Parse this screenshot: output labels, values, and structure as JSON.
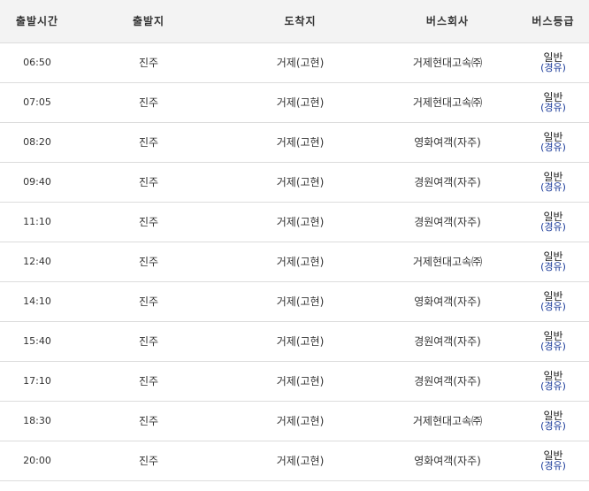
{
  "header": {
    "time": "출발시간",
    "from": "출발지",
    "to": "도착지",
    "company": "버스회사",
    "grade": "버스등급"
  },
  "rows": [
    {
      "time": "06:50",
      "from": "진주",
      "to": "거제(고현)",
      "company": "거제현대고속㈜",
      "grade": "일반",
      "grade_note": "(경유)"
    },
    {
      "time": "07:05",
      "from": "진주",
      "to": "거제(고현)",
      "company": "거제현대고속㈜",
      "grade": "일반",
      "grade_note": "(경유)"
    },
    {
      "time": "08:20",
      "from": "진주",
      "to": "거제(고현)",
      "company": "영화여객(자주)",
      "grade": "일반",
      "grade_note": "(경유)"
    },
    {
      "time": "09:40",
      "from": "진주",
      "to": "거제(고현)",
      "company": "경원여객(자주)",
      "grade": "일반",
      "grade_note": "(경유)"
    },
    {
      "time": "11:10",
      "from": "진주",
      "to": "거제(고현)",
      "company": "경원여객(자주)",
      "grade": "일반",
      "grade_note": "(경유)"
    },
    {
      "time": "12:40",
      "from": "진주",
      "to": "거제(고현)",
      "company": "거제현대고속㈜",
      "grade": "일반",
      "grade_note": "(경유)"
    },
    {
      "time": "14:10",
      "from": "진주",
      "to": "거제(고현)",
      "company": "영화여객(자주)",
      "grade": "일반",
      "grade_note": "(경유)"
    },
    {
      "time": "15:40",
      "from": "진주",
      "to": "거제(고현)",
      "company": "경원여객(자주)",
      "grade": "일반",
      "grade_note": "(경유)"
    },
    {
      "time": "17:10",
      "from": "진주",
      "to": "거제(고현)",
      "company": "경원여객(자주)",
      "grade": "일반",
      "grade_note": "(경유)"
    },
    {
      "time": "18:30",
      "from": "진주",
      "to": "거제(고현)",
      "company": "거제현대고속㈜",
      "grade": "일반",
      "grade_note": "(경유)"
    },
    {
      "time": "20:00",
      "from": "진주",
      "to": "거제(고현)",
      "company": "영화여객(자주)",
      "grade": "일반",
      "grade_note": "(경유)"
    }
  ],
  "colors": {
    "header_bg": "#f3f3f3",
    "border": "#dcdcdc",
    "link": "#1a3a99"
  }
}
